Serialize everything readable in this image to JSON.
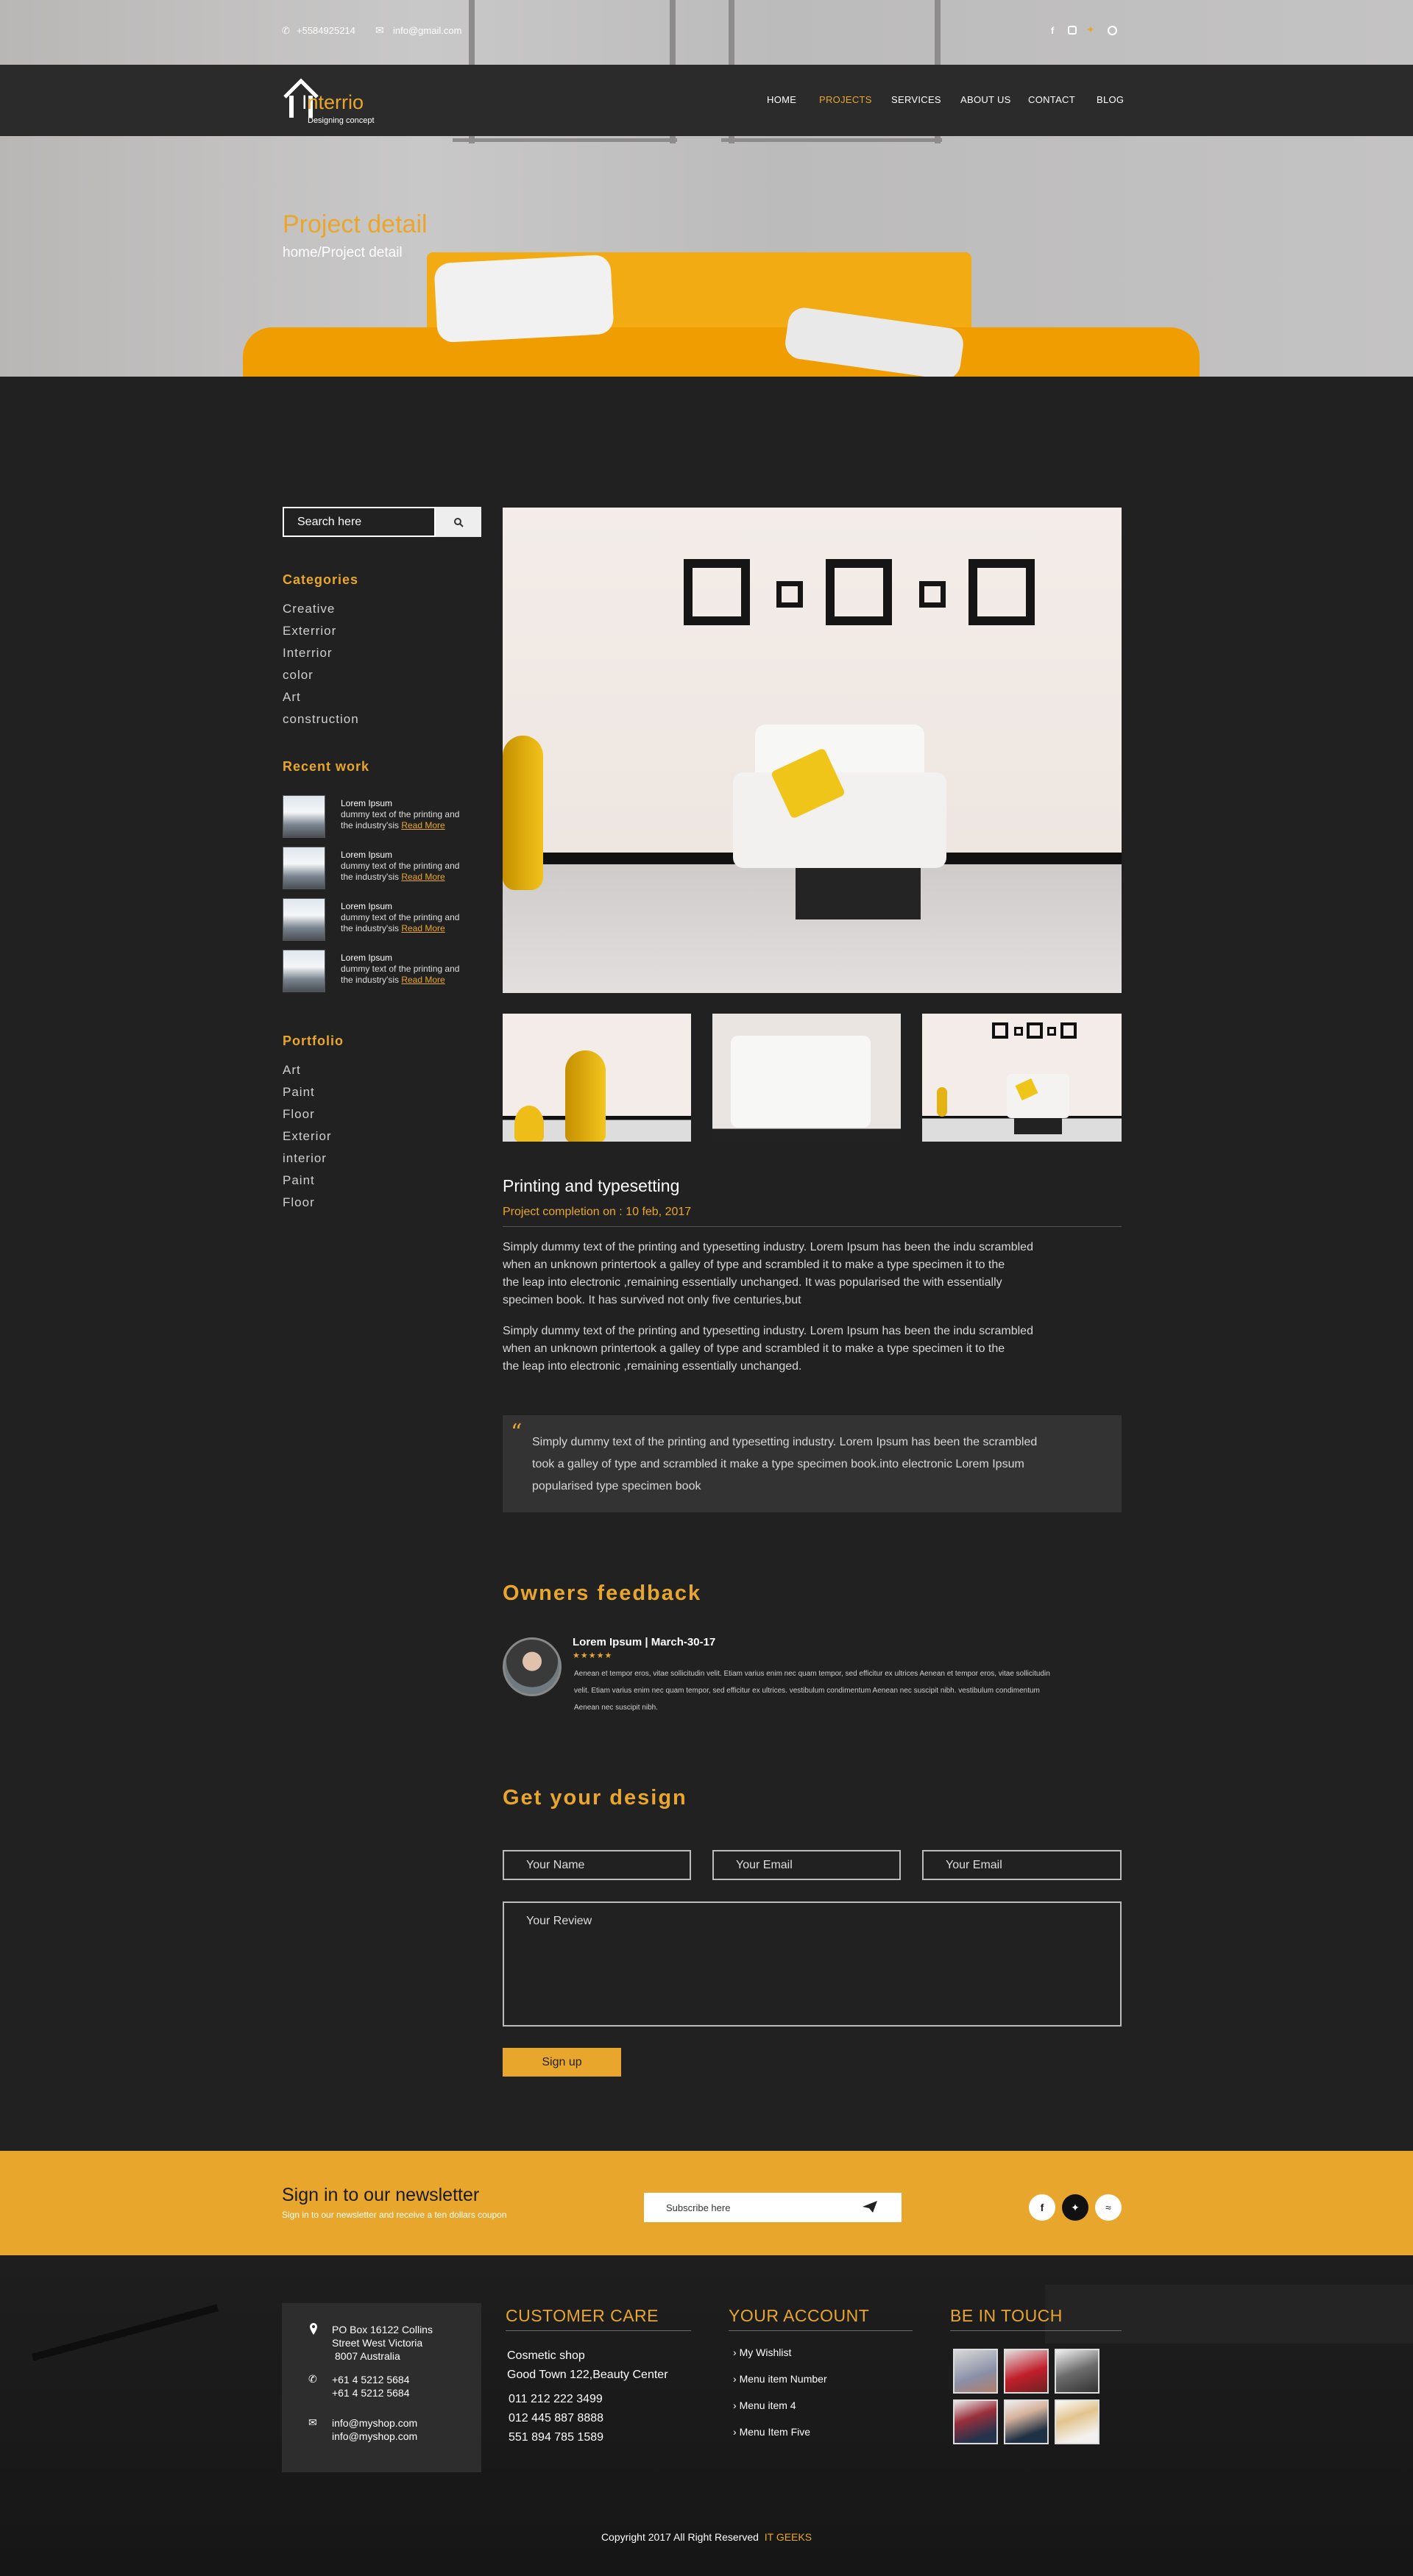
{
  "topbar": {
    "phone": "+5584925214",
    "email": "info@gmail.com",
    "social": [
      "facebook-icon",
      "instagram-icon",
      "twitter-icon",
      "pinterest-icon"
    ]
  },
  "brand": {
    "name_prefix": "I",
    "name_rest": "nterrio",
    "tagline": "Designing concept"
  },
  "nav": {
    "items": [
      "HOME",
      "PROJECTS",
      "SERVICES",
      "ABOUT US",
      "CONTACT",
      "BLOG"
    ],
    "active": "PROJECTS"
  },
  "hero": {
    "title": "Project detail",
    "breadcrumb": "home/Project detail"
  },
  "sidebar": {
    "search_placeholder": "Search here",
    "categories_title": "Categories",
    "categories": [
      "Creative",
      "Exterrior",
      "Interrior",
      "color",
      "Art",
      "construction"
    ],
    "recent_title": "Recent work",
    "recent": [
      {
        "title": "Lorem Ipsum",
        "line1": "dummy text of the printing and",
        "line2": "the industry'sis",
        "more": "Read More"
      },
      {
        "title": "Lorem Ipsum",
        "line1": "dummy text of the printing and",
        "line2": "the industry'sis",
        "more": "Read More"
      },
      {
        "title": "Lorem Ipsum",
        "line1": "dummy text of the printing and",
        "line2": "the industry'sis",
        "more": "Read More"
      },
      {
        "title": "Lorem Ipsum",
        "line1": "dummy text of the printing and",
        "line2": "the industry'sis",
        "more": "Read More"
      }
    ],
    "portfolio_title": "Portfolio",
    "portfolio": [
      "Art",
      "Paint",
      "Floor",
      "Exterior",
      "interior",
      "Paint",
      "Floor"
    ]
  },
  "project": {
    "title": "Printing and typesetting",
    "completion": "Project completion on : 10 feb, 2017",
    "para1_l1": "Simply dummy text of the printing and typesetting industry. Lorem Ipsum has been the indu scrambled",
    "para1_l2": "when an unknown printertook a galley of type and scrambled it to make a type specimen it to the",
    "para1_l3": "the leap into electronic ,remaining essentially unchanged. It was popularised the with essentially",
    "para1_l4": "specimen book. It has survived not only five centuries,but",
    "para2_l1": "Simply dummy text of the printing and typesetting industry. Lorem Ipsum has been the indu scrambled",
    "para2_l2": "when an unknown printertook a galley of type and scrambled it to make a type specimen it to the",
    "para2_l3": "the leap into electronic ,remaining essentially unchanged.",
    "quote_l1": "Simply dummy text of the printing and typesetting industry. Lorem Ipsum has been the scrambled",
    "quote_l2": "took a galley of type and scrambled it make a type specimen book.into electronic Lorem Ipsum",
    "quote_l3": "popularised type specimen book"
  },
  "feedback": {
    "title": "Owners feedback",
    "author": "Lorem Ipsum | March-30-17",
    "rating": 5,
    "stars": "★★★★★",
    "text_l1": "Aenean et tempor eros, vitae sollicitudin velit. Etiam varius enim nec quam tempor, sed efficitur ex ultrices Aenean et tempor eros, vitae sollicitudin",
    "text_l2": "velit. Etiam varius enim nec quam tempor, sed efficitur ex ultrices. vestibulum condimentum Aenean nec suscipit nibh. vestibulum condimentum",
    "text_l3": "Aenean nec suscipit nibh."
  },
  "form": {
    "title": "Get your design",
    "name_placeholder": "Your Name",
    "email_placeholder": "Your Email",
    "email2_placeholder": "Your Email",
    "review_placeholder": "Your Review",
    "submit": "Sign up"
  },
  "newsletter": {
    "title": "Sign in to our newsletter",
    "subtitle": "Sign in to our newsletter and receive a ten  dollars coupon",
    "placeholder": "Subscribe here"
  },
  "footer": {
    "address_l1": "PO Box 16122 Collins",
    "address_l2": "Street West Victoria",
    "address_l3": "8007 Australia",
    "phone_l1": "+61 4 5212 5684",
    "phone_l2": "+61 4 5212 5684",
    "mail_l1": "info@myshop.com",
    "mail_l2": "info@myshop.com",
    "care_title": "CUSTOMER CARE",
    "care_l1": "Cosmetic shop",
    "care_l2": "Good Town 122,Beauty Center",
    "care_phones": [
      "011 212 222 3499",
      "012 445 887 8888",
      "551 894 785 1589"
    ],
    "account_title": "YOUR ACCOUNT",
    "account_items": [
      "My Wishlist",
      "Menu item Number",
      "Menu item 4",
      "Menu Item Five"
    ],
    "touch_title": "BE IN TOUCH",
    "copyright": "Copyright 2017  All Right Reserved",
    "company": "IT GEEKS"
  },
  "colors": {
    "accent": "#e8a72c",
    "dark": "#212121",
    "navbar": "#2b2b2b"
  }
}
